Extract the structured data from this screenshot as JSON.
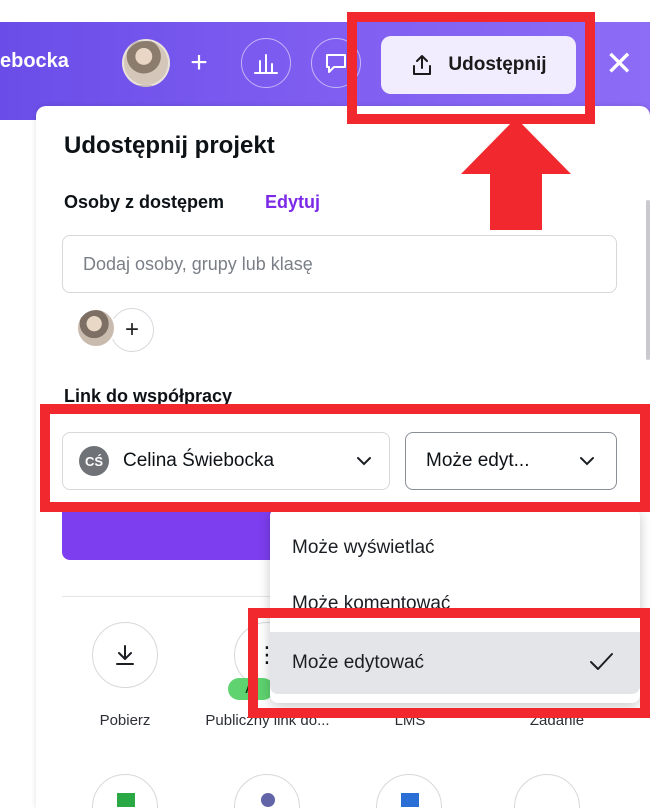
{
  "topbar": {
    "team_name": "ebocka",
    "share_label": "Udostępnij"
  },
  "panel": {
    "title": "Udostępnij projekt",
    "access_label": "Osoby z dostępem",
    "edit_link": "Edytuj",
    "people_placeholder": "Dodaj osoby, grupy lub klasę",
    "collab_label": "Link do współpracy",
    "owner": {
      "initials": "CŚ",
      "name": "Celina Świebocka"
    },
    "permission_selected": "Może edyt..."
  },
  "menu": {
    "items": [
      {
        "label": "Może wyświetlać"
      },
      {
        "label": "Może komentować"
      },
      {
        "label": "Może edytować",
        "selected": true
      }
    ]
  },
  "actions": [
    {
      "label": "Pobierz",
      "icon": "download-icon"
    },
    {
      "label": "Publiczny link do...",
      "icon": "link-icon",
      "badge": "AI"
    },
    {
      "label": "LMS",
      "icon": "lms-icon"
    },
    {
      "label": "Zadanie",
      "icon": "assignment-icon"
    }
  ],
  "colors": {
    "brand_purple": "#7d3ef0",
    "highlight_red": "#f1292f",
    "badge_green": "#5ed36f"
  }
}
